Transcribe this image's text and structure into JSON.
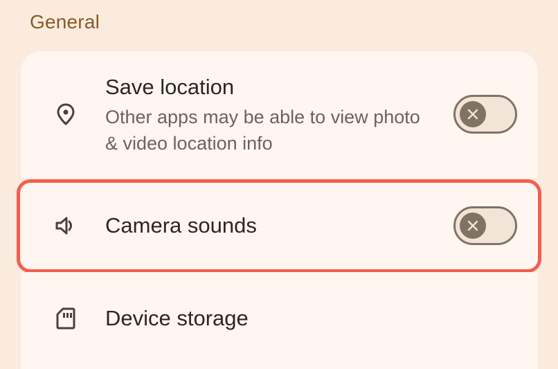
{
  "section": {
    "title": "General"
  },
  "settings": [
    {
      "title": "Save location",
      "subtitle": "Other apps may be able to view photo & video location info",
      "icon": "location-pin-icon",
      "toggle": {
        "checked": false,
        "thumb_icon": "close-icon"
      }
    },
    {
      "title": "Camera sounds",
      "icon": "speaker-icon",
      "toggle": {
        "checked": false,
        "thumb_icon": "close-icon"
      },
      "highlighted": true
    },
    {
      "title": "Device storage",
      "icon": "sd-card-icon"
    }
  ],
  "colors": {
    "background": "#fbebdf",
    "card": "#fff6f1",
    "section_title": "#8a5a24",
    "highlight": "#f45d4e",
    "toggle_outline": "#817266"
  }
}
